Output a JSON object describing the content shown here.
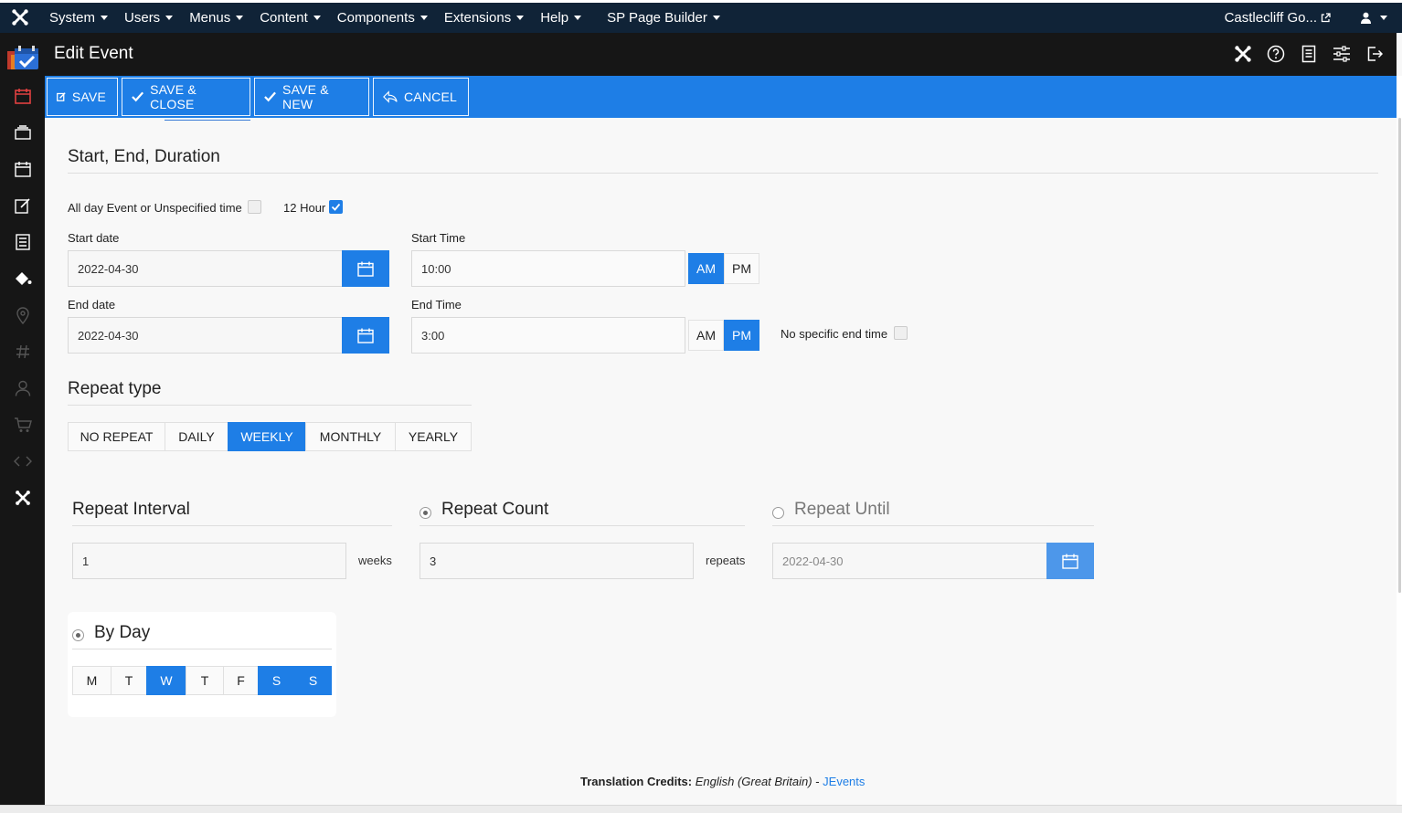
{
  "topbar": {
    "menu": [
      "System",
      "Users",
      "Menus",
      "Content",
      "Components",
      "Extensions",
      "Help"
    ],
    "page_builder": "SP Page Builder",
    "site_name": "Castlecliff Go..."
  },
  "titlebar": {
    "title": "Edit Event"
  },
  "toolbar": {
    "save": "SAVE",
    "save_close": "SAVE & CLOSE",
    "save_new": "SAVE & NEW",
    "cancel": "CANCEL"
  },
  "form": {
    "section_title": "Start, End, Duration",
    "all_day_label": "All day Event or Unspecified time",
    "all_day_checked": false,
    "twelve_hour_label": "12 Hour",
    "twelve_hour_checked": true,
    "start_date_label": "Start date",
    "start_date": "2022-04-30",
    "start_time_label": "Start Time",
    "start_time": "10:00",
    "start_ampm": "AM",
    "end_date_label": "End date",
    "end_date": "2022-04-30",
    "end_time_label": "End Time",
    "end_time": "3:00",
    "end_ampm": "PM",
    "am": "AM",
    "pm": "PM",
    "no_end_label": "No specific end time",
    "no_end_checked": false
  },
  "repeat": {
    "title": "Repeat type",
    "types": [
      "NO REPEAT",
      "DAILY",
      "WEEKLY",
      "MONTHLY",
      "YEARLY"
    ],
    "selected_type": "WEEKLY",
    "interval_title": "Repeat Interval",
    "interval_value": "1",
    "interval_unit": "weeks",
    "count_title": "Repeat Count",
    "count_value": "3",
    "count_unit": "repeats",
    "count_selected": true,
    "until_title": "Repeat Until",
    "until_value": "2022-04-30",
    "until_selected": false,
    "by_day_title": "By Day",
    "days": [
      "M",
      "T",
      "W",
      "T",
      "F",
      "S",
      "S"
    ],
    "days_selected": [
      false,
      false,
      true,
      false,
      false,
      true,
      true
    ]
  },
  "footer": {
    "credits_label": "Translation Credits:",
    "language": "English (Great Britain)",
    "separator": " - ",
    "link": "JEvents"
  },
  "colors": {
    "accent": "#1e7ee6",
    "topbar": "#102337",
    "dark": "#161616"
  }
}
